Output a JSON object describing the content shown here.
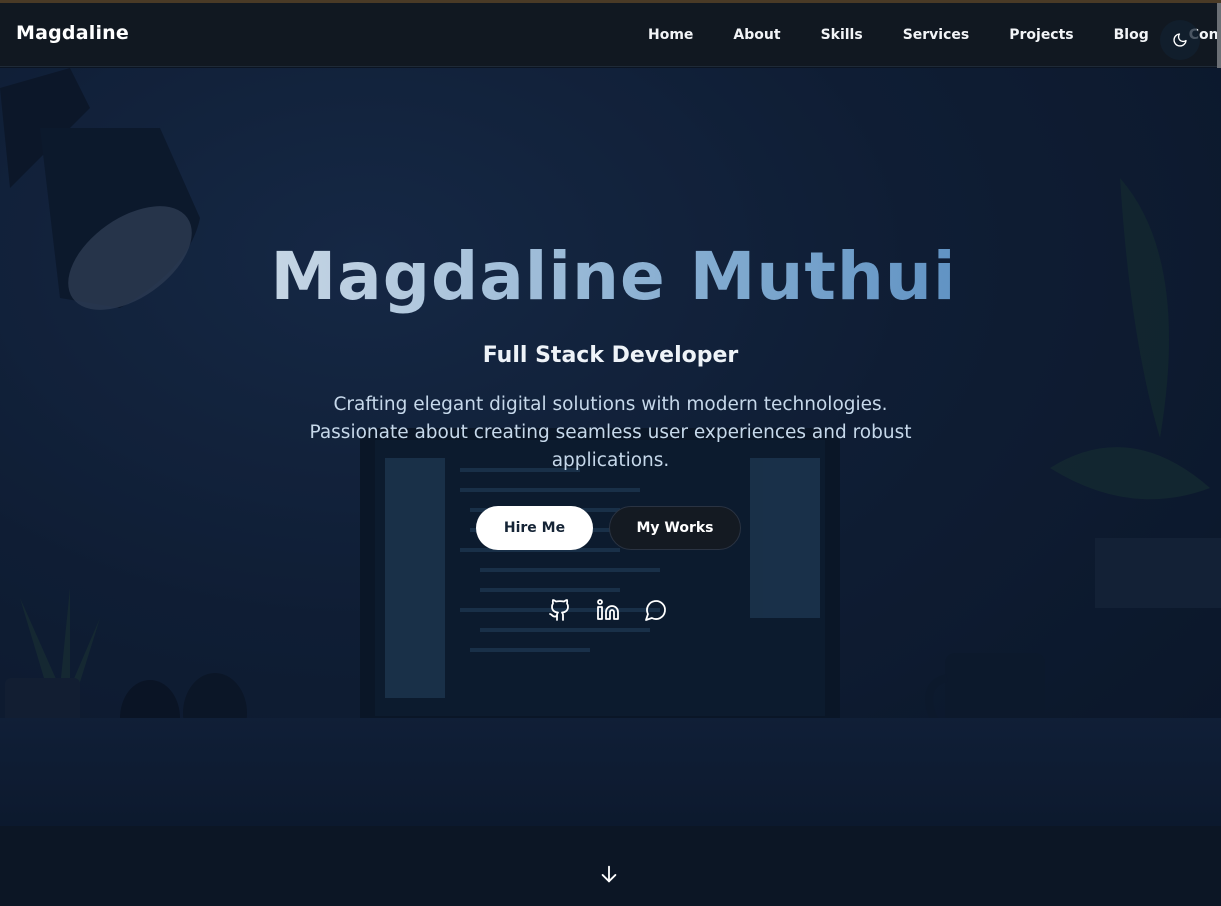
{
  "nav": {
    "brand": "Magdaline",
    "links": [
      "Home",
      "About",
      "Skills",
      "Services",
      "Projects",
      "Blog",
      "Contact"
    ],
    "theme_toggle_icon": "moon-icon"
  },
  "hero": {
    "title": "Magdaline Muthui",
    "subtitle": "Full Stack Developer",
    "description": "Crafting elegant digital solutions with modern technologies. Passionate about creating seamless user experiences and robust applications.",
    "buttons": {
      "hire": "Hire Me",
      "works": "My Works"
    },
    "socials": [
      "github-icon",
      "linkedin-icon",
      "chat-icon"
    ],
    "scroll_icon": "arrow-down-icon"
  },
  "colors": {
    "nav_bg": "#111821",
    "hero_bg": "#13233d",
    "accent_blue": "#3d79b6",
    "hire_bg": "#ffffff",
    "works_bg": "#141a22"
  }
}
